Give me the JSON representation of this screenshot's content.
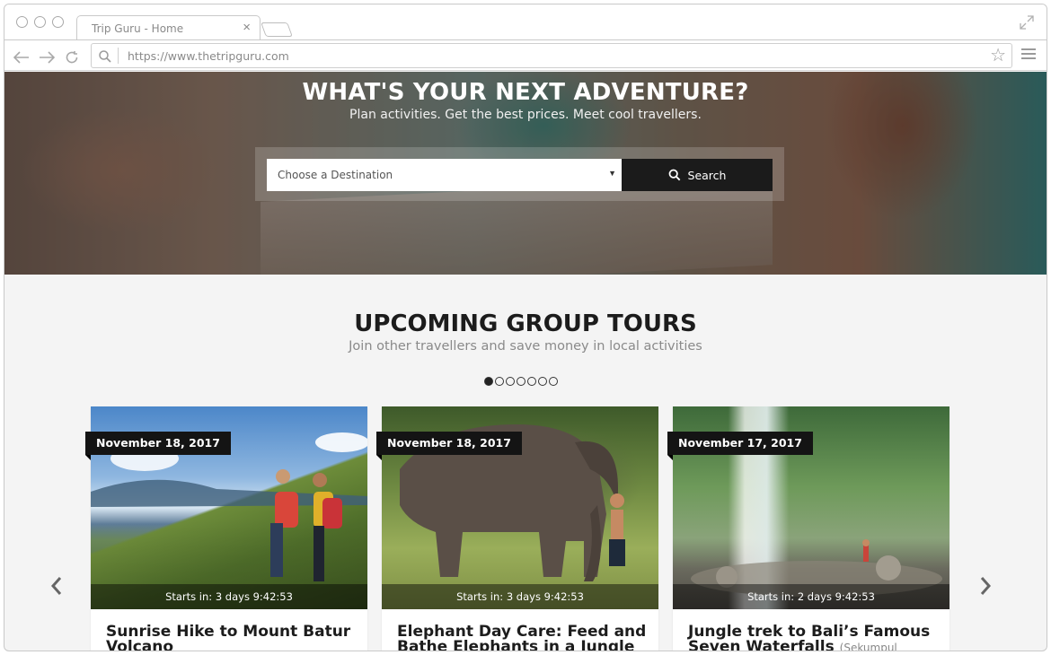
{
  "browser": {
    "tab_title": "Trip Guru - Home",
    "url": "https://www.thetripguru.com"
  },
  "hero": {
    "title": "WHAT'S YOUR NEXT ADVENTURE?",
    "subtitle": "Plan activities. Get the best prices. Meet cool travellers.",
    "destination_placeholder": "Choose a Destination",
    "search_label": "Search"
  },
  "section": {
    "title": "UPCOMING GROUP TOURS",
    "subtitle": "Join other travellers and save money in local activities",
    "dot_count": 7,
    "active_dot": 0
  },
  "cards": [
    {
      "date": "November 18, 2017",
      "timer": "Starts in: 3 days 9:42:53",
      "title_line1": "Sunrise Hike to Mount Batur",
      "title_line2": "Volcano",
      "title_extra": ""
    },
    {
      "date": "November 18, 2017",
      "timer": "Starts in: 3 days 9:42:53",
      "title_line1": "Elephant Day Care: Feed and",
      "title_line2": "Bathe Elephants in a Jungle",
      "title_extra": ""
    },
    {
      "date": "November 17, 2017",
      "timer": "Starts in: 2 days 9:42:53",
      "title_line1": "Jungle trek to Bali’s Famous",
      "title_line2": "Seven Waterfalls",
      "title_extra": "(Sekumpul Waterfalls)"
    }
  ],
  "colors": {
    "accent_dark": "#1b1b1b",
    "page_bg": "#f4f4f4"
  }
}
